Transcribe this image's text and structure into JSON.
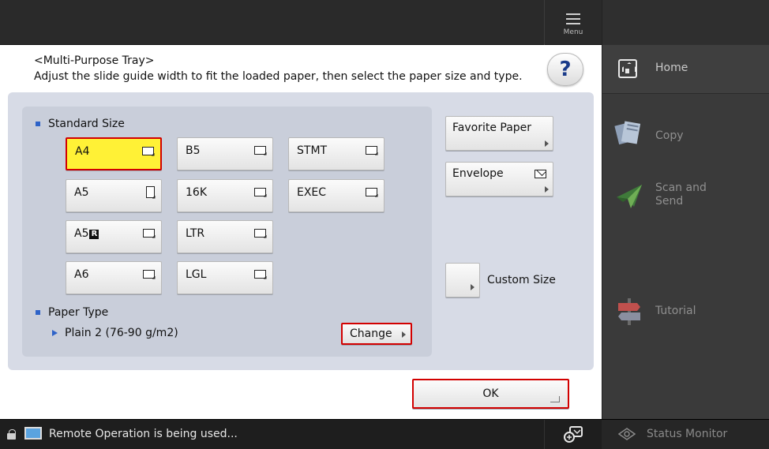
{
  "topbar": {
    "menu_label": "Menu"
  },
  "dialog": {
    "title": "<Multi-Purpose Tray>",
    "instruction": "Adjust the slide guide width to fit the loaded paper, then select the paper size and type.",
    "help_label": "?"
  },
  "standard_size": {
    "title": "Standard Size",
    "sizes": [
      {
        "label": "A4",
        "orientation": "landscape",
        "selected": true
      },
      {
        "label": "B5",
        "orientation": "landscape"
      },
      {
        "label": "STMT",
        "orientation": "landscape"
      },
      {
        "label": "A5",
        "orientation": "portrait"
      },
      {
        "label": "16K",
        "orientation": "landscape"
      },
      {
        "label": "EXEC",
        "orientation": "landscape"
      },
      {
        "label": "A5",
        "badge": "R",
        "orientation": "landscape"
      },
      {
        "label": "LTR",
        "orientation": "landscape"
      },
      {
        "label": "A6",
        "orientation": "landscape"
      },
      {
        "label": "LGL",
        "orientation": "landscape"
      }
    ]
  },
  "side_buttons": {
    "favorite_paper": "Favorite Paper",
    "envelope": "Envelope",
    "custom_size": "Custom Size"
  },
  "paper_type": {
    "title": "Paper Type",
    "value": "Plain 2 (76-90 g/m2)",
    "change_label": "Change"
  },
  "ok_label": "OK",
  "nav": {
    "home": "Home",
    "copy": "Copy",
    "scan_send_line1": "Scan and",
    "scan_send_line2": "Send",
    "tutorial": "Tutorial"
  },
  "status": {
    "message": "Remote Operation is being used...",
    "status_monitor": "Status Monitor"
  },
  "colors": {
    "selected_fill": "#fff136",
    "highlight_border": "#d20000",
    "bullet_blue": "#2e63c8"
  }
}
